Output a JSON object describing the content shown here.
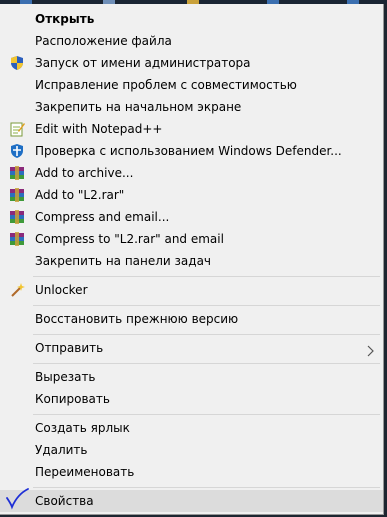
{
  "menu": {
    "items": [
      {
        "label": "Открыть",
        "icon": ""
      },
      {
        "label": "Расположение файла",
        "icon": ""
      },
      {
        "label": "Запуск от имени администратора",
        "icon": "uac-shield-icon"
      },
      {
        "label": "Исправление проблем с совместимостью",
        "icon": ""
      },
      {
        "label": "Закрепить на начальном экране",
        "icon": ""
      },
      {
        "label": "Edit with Notepad++",
        "icon": "notepadpp-icon"
      },
      {
        "label": "Проверка с использованием Windows Defender...",
        "icon": "defender-icon"
      },
      {
        "label": "Add to archive...",
        "icon": "winrar-icon"
      },
      {
        "label": "Add to \"L2.rar\"",
        "icon": "winrar-icon"
      },
      {
        "label": "Compress and email...",
        "icon": "winrar-icon"
      },
      {
        "label": "Compress to \"L2.rar\" and email",
        "icon": "winrar-icon"
      },
      {
        "label": "Закрепить на панели задач",
        "icon": ""
      },
      {
        "label": "Unlocker",
        "icon": "unlocker-wand-icon"
      },
      {
        "label": "Восстановить прежнюю версию",
        "icon": ""
      },
      {
        "label": "Отправить",
        "icon": ""
      },
      {
        "label": "Вырезать",
        "icon": ""
      },
      {
        "label": "Копировать",
        "icon": ""
      },
      {
        "label": "Создать ярлык",
        "icon": ""
      },
      {
        "label": "Удалить",
        "icon": ""
      },
      {
        "label": "Переименовать",
        "icon": ""
      },
      {
        "label": "Свойства",
        "icon": "checkmark-icon"
      }
    ],
    "submenu_arrow_icon": "chevron-right-icon",
    "selected_item": "Свойства"
  },
  "colors": {
    "menu_bg": "#f0f0f0",
    "selected_bg": "#dcdcdc",
    "separator": "#d6d6d6",
    "checkmark": "#1e2fd6",
    "desktop_bg": "#1d2530"
  }
}
